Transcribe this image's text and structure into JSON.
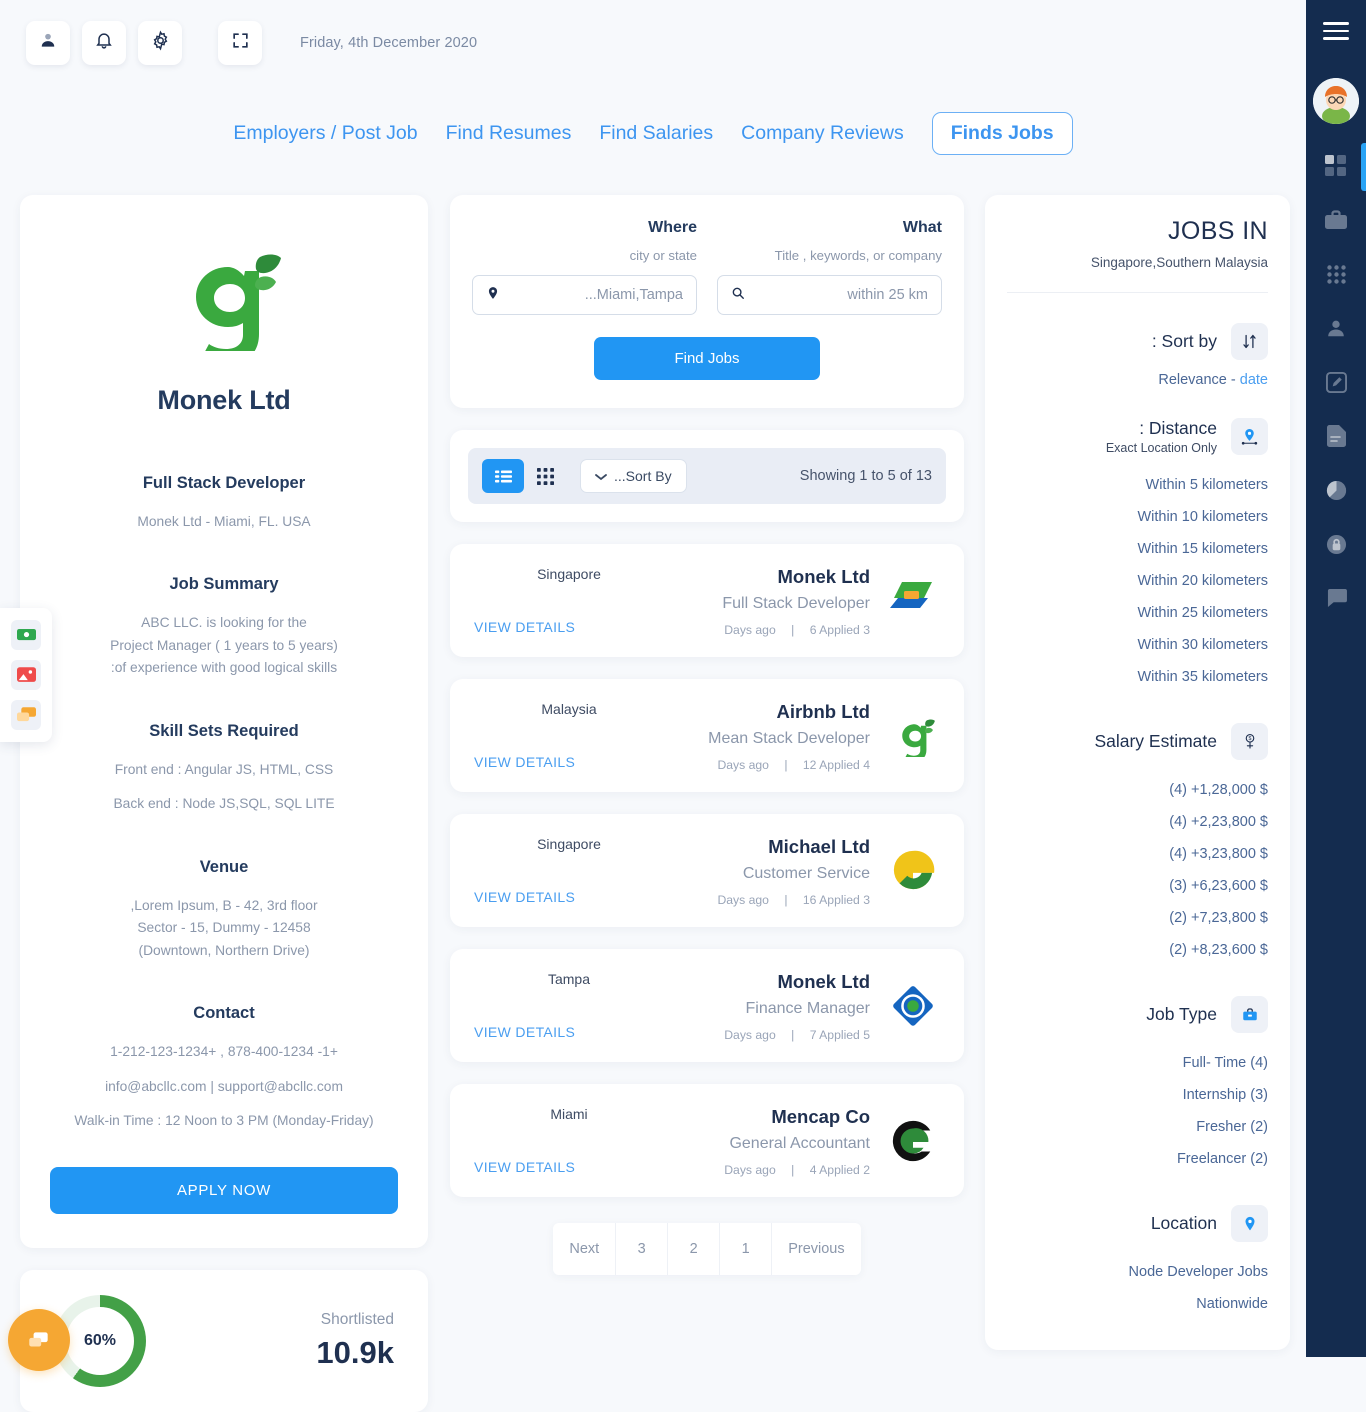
{
  "topbar": {
    "icons": [
      "user-icon",
      "bell-icon",
      "gear-icon",
      "fullscreen-icon"
    ],
    "date": "Friday, 4th December 2020"
  },
  "nav": {
    "items": [
      {
        "label": "Employers / Post Job",
        "active": false
      },
      {
        "label": "Find Resumes",
        "active": false
      },
      {
        "label": "Find Salaries",
        "active": false
      },
      {
        "label": "Company Reviews",
        "active": false
      },
      {
        "label": "Finds Jobs",
        "active": true
      }
    ]
  },
  "job_detail": {
    "company": "Monek Ltd",
    "role": "Full Stack Developer",
    "location_line": "Monek Ltd - Miami, FL. USA",
    "summary_title": "Job Summary",
    "summary_lines": [
      "ABC LLC. is looking for the",
      "Project Manager ( 1 years to 5 years)",
      ":of experience with good logical skills"
    ],
    "skills_title": "Skill Sets Required",
    "skills_lines": [
      "Front end : Angular JS, HTML, CSS",
      "Back end : Node JS,SQL, SQL LITE"
    ],
    "venue_title": "Venue",
    "venue_lines": [
      ",Lorem Ipsum, B - 42, 3rd floor",
      "Sector - 15, Dummy - 12458",
      "(Downtown, Northern Drive)"
    ],
    "contact_title": "Contact",
    "contact_lines": [
      "1-212-123-1234+ , 878-400-1234 -1+",
      "info@abcllc.com | support@abcllc.com",
      "Walk-in Time : 12 Noon to 3 PM (Monday-Friday)"
    ],
    "apply_label": "APPLY NOW"
  },
  "shortlisted": {
    "percent_label": "60%",
    "percent_value": 60,
    "title": "Shortlisted",
    "value": "10.9k"
  },
  "search": {
    "where_title": "Where",
    "where_sub": "city or state",
    "where_value": "...Miami,Tampa",
    "what_title": "What",
    "what_sub": "Title , keywords, or company",
    "what_value": "within 25 km",
    "button": "Find Jobs"
  },
  "toolbar": {
    "sort_label": "...Sort By",
    "showing": "Showing 1 to 5 of 13"
  },
  "jobs": [
    {
      "location": "Singapore",
      "company": "Monek Ltd",
      "title": "Full Stack Developer",
      "days": "Days ago",
      "applied": "6 Applied 3",
      "view": "VIEW DETAILS",
      "logo": "arrow-green-blue-logo"
    },
    {
      "location": "Malaysia",
      "company": "Airbnb Ltd",
      "title": "Mean Stack Developer",
      "days": "Days ago",
      "applied": "12 Applied 4",
      "view": "VIEW DETAILS",
      "logo": "green-g-leaf-logo"
    },
    {
      "location": "Singapore",
      "company": "Michael Ltd",
      "title": "Customer Service",
      "days": "Days ago",
      "applied": "16 Applied 3",
      "view": "VIEW DETAILS",
      "logo": "yellow-green-g-logo"
    },
    {
      "location": "Tampa",
      "company": "Monek Ltd",
      "title": "Finance Manager",
      "days": "Days ago",
      "applied": "7 Applied 5",
      "view": "VIEW DETAILS",
      "logo": "blue-diamond-target-logo"
    },
    {
      "location": "Miami",
      "company": "Mencap Co",
      "title": "General Accountant",
      "days": "Days ago",
      "applied": "4 Applied 2",
      "view": "VIEW DETAILS",
      "logo": "black-green-c-logo"
    }
  ],
  "pagination": [
    "Next",
    "3",
    "2",
    "1",
    "Previous"
  ],
  "sidebar": {
    "header_title": "JOBS IN",
    "header_sub": "Singapore,Southern Malaysia",
    "sort": {
      "title": ": Sort by",
      "icon": "sort-arrows-icon",
      "relevance": "Relevance - ",
      "date": "date"
    },
    "distance": {
      "title": ": Distance",
      "sub": "Exact Location Only",
      "icon": "distance-pin-icon",
      "items": [
        "Within 5 kilometers",
        "Within 10 kilometers",
        "Within 15 kilometers",
        "Within 20 kilometers",
        "Within 25 kilometers",
        "Within 30 kilometers",
        "Within 35 kilometers"
      ]
    },
    "salary": {
      "title": "Salary Estimate",
      "icon": "salary-icon",
      "items": [
        "(4) +1,28,000 $",
        "(4) +2,23,800 $",
        "(4) +3,23,800 $",
        "(3) +6,23,600 $",
        "(2) +7,23,800 $",
        "(2) +8,23,600 $"
      ]
    },
    "job_type": {
      "title": "Job Type",
      "icon": "briefcase-icon",
      "items": [
        "Full- Time (4)",
        "Internship (3)",
        "Fresher (2)",
        "Freelancer (2)"
      ]
    },
    "location": {
      "title": "Location",
      "icon": "map-pin-icon",
      "items": [
        "Node Developer Jobs",
        "Nationwide"
      ]
    }
  },
  "rail": {
    "menu_icon": "hamburger-icon",
    "avatar": "user-avatar",
    "icons": [
      "dashboard-icon",
      "briefcase-icon",
      "apps-grid-icon",
      "user-icon",
      "edit-icon",
      "document-icon",
      "pie-chart-icon",
      "lock-icon",
      "chat-icon"
    ]
  },
  "floatbar": {
    "items": [
      "money-icon",
      "image-icon",
      "chat-icon"
    ]
  },
  "colors": {
    "accent": "#2196f3",
    "link": "#4a9ef0",
    "navy": "#142c4f",
    "text": "#1f3050",
    "muted": "#8b97ab",
    "green": "#43a047",
    "orange": "#f5a733"
  }
}
